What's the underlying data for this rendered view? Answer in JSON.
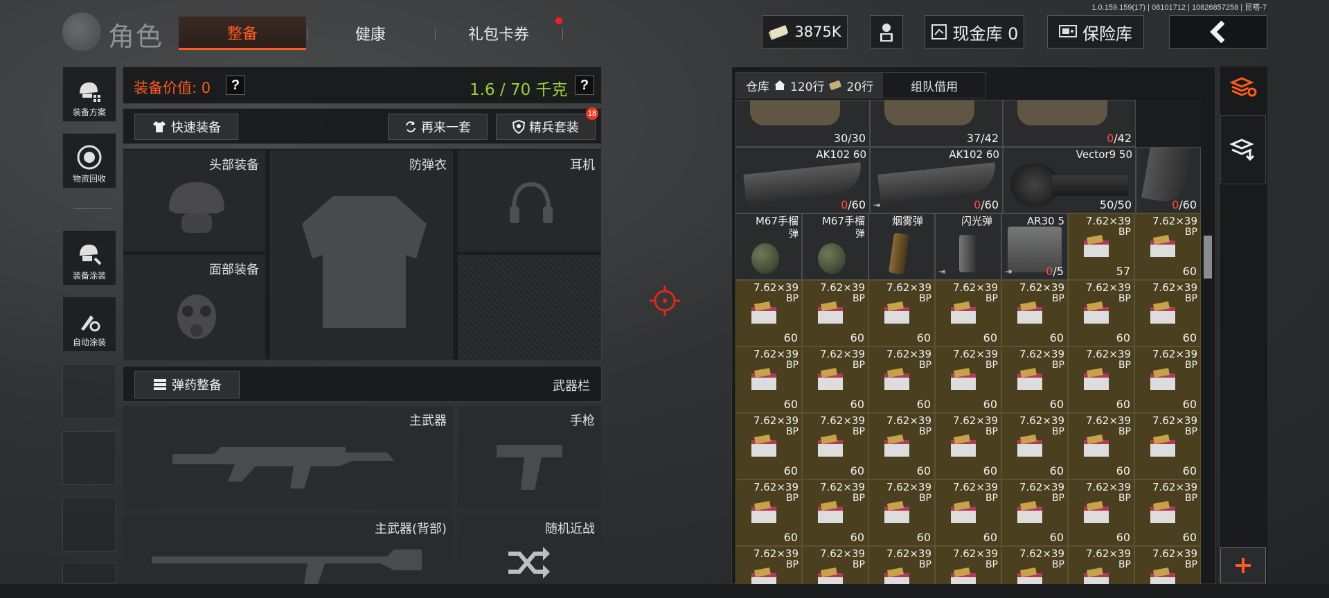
{
  "version": "1.0.159.159(17) | 08101712 | 10826857258 | 昆嗒-7",
  "header": {
    "title": "角色",
    "tabs": [
      {
        "label": "整备",
        "active": true
      },
      {
        "label": "健康",
        "active": false
      },
      {
        "label": "礼包卡券",
        "active": false,
        "notify": true
      }
    ],
    "currency": "3875K",
    "cash_vault": "现金库 0",
    "safe_box": "保险库"
  },
  "rail": {
    "items": [
      {
        "label": "装备方案",
        "icon": "helmet-grid-icon"
      },
      {
        "label": "物资回收",
        "icon": "recycle-icon"
      },
      {
        "label": "装备涂装",
        "icon": "helmet-paint-icon"
      },
      {
        "label": "自动涂装",
        "icon": "brush-gear-icon"
      }
    ]
  },
  "loadout": {
    "value_label": "装备价值: 0",
    "weight_label": "1.6 / 70 千克",
    "help": "?",
    "quick_equip": "快速装备",
    "reroll": "再来一套",
    "elite_set": "精兵套装",
    "elite_badge": "18",
    "slots": {
      "head": "头部装备",
      "armor": "防弹衣",
      "headset": "耳机",
      "face": "面部装备"
    },
    "ammo_organize": "弹药整备",
    "weapon_bar": "武器栏",
    "primary": "主武器",
    "pistol": "手枪",
    "primary_back": "主武器(背部)",
    "random_melee": "随机近战"
  },
  "inventory": {
    "tabs": [
      {
        "label": "仓库",
        "icon": "warehouse-icon"
      },
      {
        "label": "120行",
        "icon": "house-icon"
      },
      {
        "label": "20行",
        "icon": "ticket-icon"
      },
      {
        "label": "组队借用",
        "icon": ""
      }
    ],
    "row0": [
      {
        "count_zero": "",
        "count_rest": "30/30"
      },
      {
        "count_zero": "",
        "count_rest": "37/42"
      },
      {
        "count_zero": "0",
        "count_rest": "/42"
      }
    ],
    "row1": [
      {
        "name": "AK102 60",
        "count_zero": "0",
        "count_rest": "/60"
      },
      {
        "name": "AK102 60",
        "count_zero": "0",
        "count_rest": "/60"
      },
      {
        "name": "Vector9 50",
        "count_zero": "",
        "count_rest": "50/50"
      },
      {
        "name": "",
        "count_zero": "0",
        "count_rest": "/60"
      }
    ],
    "row2": [
      {
        "name": "M67手榴",
        "sub": "弹",
        "count": ""
      },
      {
        "name": "M67手榴",
        "sub": "弹",
        "count": ""
      },
      {
        "name": "烟雾弹",
        "sub": "",
        "count": ""
      },
      {
        "name": "闪光弹",
        "sub": "",
        "count": ""
      },
      {
        "name": "AR30 5",
        "sub": "",
        "count_zero": "0",
        "count_rest": "/5"
      },
      {
        "name": "7.62×39",
        "sub": "BP",
        "count": "57"
      },
      {
        "name": "7.62×39",
        "sub": "BP",
        "count": "60"
      }
    ],
    "ammo_name": "7.62×39",
    "ammo_sub": "BP",
    "ammo_count": "60"
  },
  "colors": {
    "accent": "#ff5a1f",
    "weight_green": "#9ad23a",
    "ammo_bg": "#4a3f1e",
    "zero_red": "#ff4a4a"
  }
}
